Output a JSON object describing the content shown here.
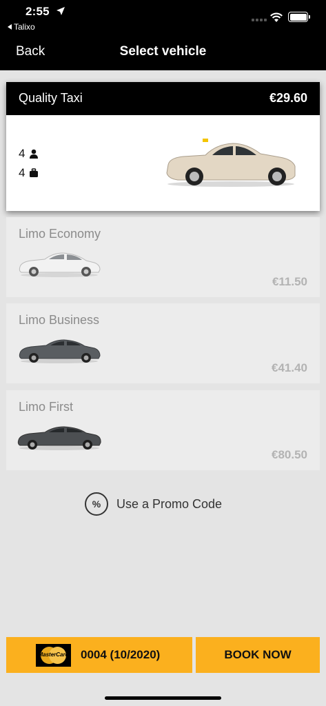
{
  "status": {
    "time": "2:55",
    "back_app": "Talixo"
  },
  "nav": {
    "back_label": "Back",
    "title": "Select vehicle"
  },
  "selected_vehicle": {
    "name": "Quality Taxi",
    "price": "€29.60",
    "passengers": "4",
    "luggage": "4"
  },
  "vehicles": [
    {
      "name": "Limo Economy",
      "price": "€11.50"
    },
    {
      "name": "Limo Business",
      "price": "€41.40"
    },
    {
      "name": "Limo First",
      "price": "€80.50"
    }
  ],
  "promo": {
    "icon_text": "%",
    "label": "Use a Promo Code"
  },
  "payment": {
    "card_brand": "MasterCard",
    "card_label": "0004 (10/2020)"
  },
  "book": {
    "label": "BOOK NOW"
  },
  "colors": {
    "accent": "#fbb01e",
    "header": "#000000",
    "background": "#e4e4e4"
  },
  "icons": [
    "location-arrow-icon",
    "back-triangle-icon",
    "cellular-icon",
    "wifi-icon",
    "battery-icon",
    "person-icon",
    "luggage-icon",
    "taxi-car-image",
    "sedan-car-image",
    "promo-percent-icon",
    "mastercard-logo"
  ]
}
